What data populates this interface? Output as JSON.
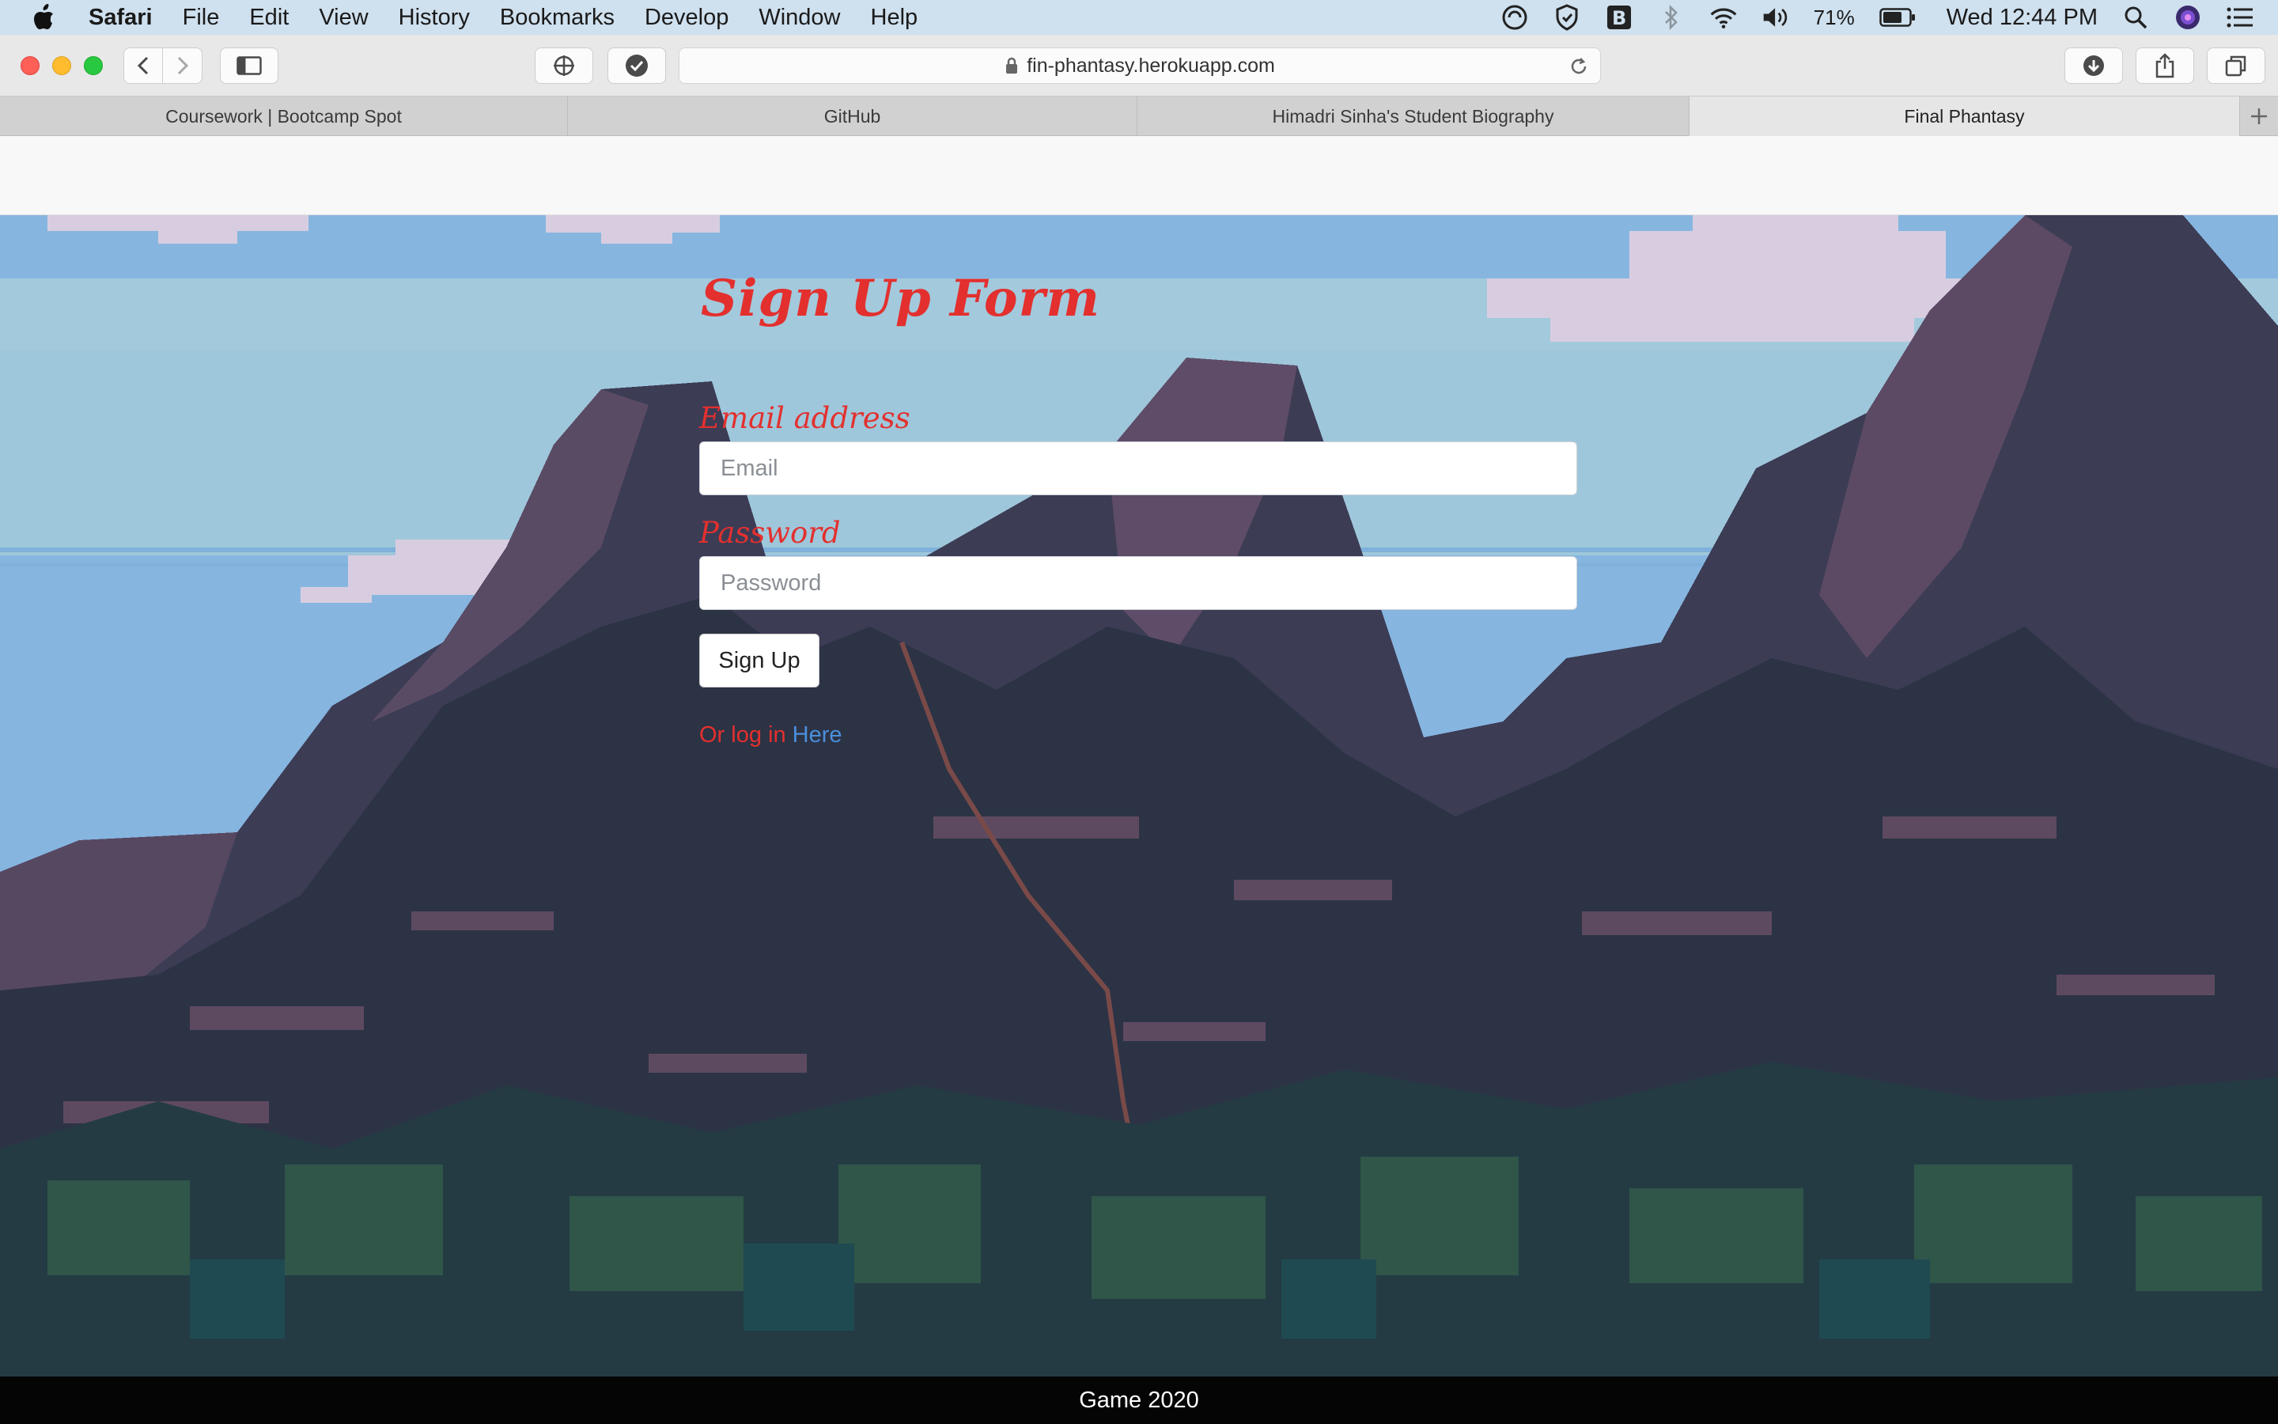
{
  "menubar": {
    "app_name": "Safari",
    "items": [
      "File",
      "Edit",
      "View",
      "History",
      "Bookmarks",
      "Develop",
      "Window",
      "Help"
    ],
    "battery": "71%",
    "clock": "Wed 12:44 PM"
  },
  "toolbar": {
    "url": "fin-phantasy.herokuapp.com"
  },
  "tabs": [
    {
      "label": "Coursework | Bootcamp Spot"
    },
    {
      "label": "GitHub"
    },
    {
      "label": "Himadri Sinha's Student Biography"
    },
    {
      "label": "Final Phantasy"
    }
  ],
  "form": {
    "title": "Sign Up Form",
    "email_label": "Email address",
    "email_placeholder": "Email",
    "password_label": "Password",
    "password_placeholder": "Password",
    "submit_label": "Sign Up",
    "login_prefix": "Or log in",
    "login_link": "Here"
  },
  "footer": {
    "text": "Game 2020"
  },
  "colors": {
    "label_red": "#e3302e",
    "link_blue": "#4a8fdc",
    "sky": "#86b6e0",
    "mountain_dark": "#2c3345"
  }
}
